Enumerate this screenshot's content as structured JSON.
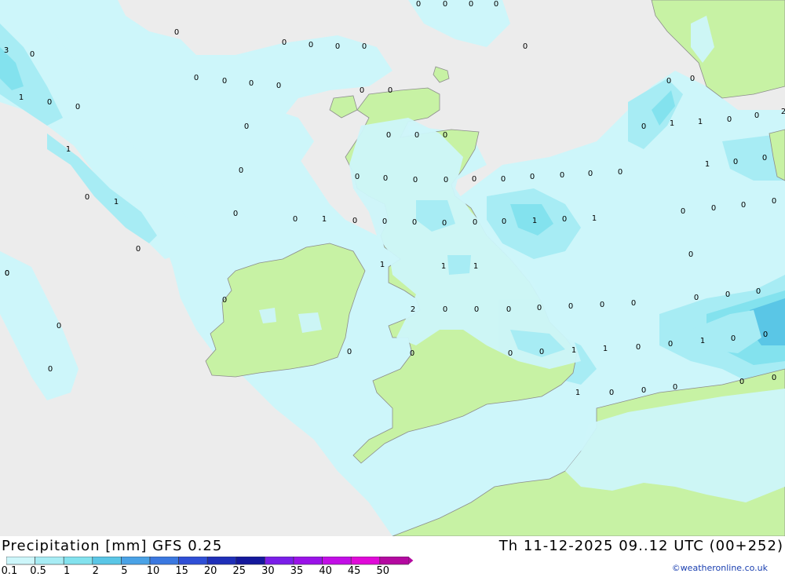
{
  "title": {
    "left": "Precipitation [mm] GFS 0.25",
    "right": "Th 11-12-2025 09..12 UTC (00+252)",
    "credit": "©weatheronline.co.uk"
  },
  "colors": {
    "sea": "#ececec",
    "land": "#c7f2a4",
    "border": "#8c8c8c",
    "precip_0_1": "#cdf6fa",
    "precip_0_5": "#a7ecf4",
    "precip_1": "#83e2ee",
    "precip_2": "#5ac6e6"
  },
  "legend": {
    "unit": "mm",
    "classes": [
      {
        "label": "0.1",
        "color": "#cdf6fa"
      },
      {
        "label": "0.5",
        "color": "#a7ecf4"
      },
      {
        "label": "1",
        "color": "#83e2ee"
      },
      {
        "label": "2",
        "color": "#5ac6e6"
      },
      {
        "label": "5",
        "color": "#4aa2e6"
      },
      {
        "label": "10",
        "color": "#3b78e0"
      },
      {
        "label": "15",
        "color": "#2f4fd6"
      },
      {
        "label": "20",
        "color": "#1f2fb8"
      },
      {
        "label": "25",
        "color": "#14189c"
      },
      {
        "label": "30",
        "color": "#7a1ee8"
      },
      {
        "label": "35",
        "color": "#9a12e8"
      },
      {
        "label": "40",
        "color": "#c20ee6"
      },
      {
        "label": "45",
        "color": "#e00ad8"
      },
      {
        "label": "50",
        "color": "#b40aa0"
      }
    ]
  },
  "map_values": {
    "note_none": "",
    "points": [
      {
        "v": "0"
      },
      {
        "v": "0"
      },
      {
        "v": "0"
      },
      {
        "v": "0"
      },
      {
        "v": "0"
      },
      {
        "v": "0"
      },
      {
        "v": "0"
      },
      {
        "v": "0"
      },
      {
        "v": "3"
      },
      {
        "v": "0"
      },
      {
        "v": "1"
      },
      {
        "v": "0"
      },
      {
        "v": "0"
      },
      {
        "v": "1"
      },
      {
        "v": "0"
      },
      {
        "v": "1"
      },
      {
        "v": "0"
      },
      {
        "v": "0"
      },
      {
        "v": "0"
      },
      {
        "v": "0"
      },
      {
        "v": "0"
      },
      {
        "v": "0"
      },
      {
        "v": "0"
      },
      {
        "v": "0"
      },
      {
        "v": "0"
      },
      {
        "v": "0"
      },
      {
        "v": "0"
      },
      {
        "v": "0"
      },
      {
        "v": "0"
      },
      {
        "v": "0"
      },
      {
        "v": "1"
      },
      {
        "v": "0"
      },
      {
        "v": "0"
      },
      {
        "v": "0"
      },
      {
        "v": "0"
      },
      {
        "v": "0"
      },
      {
        "v": "0"
      },
      {
        "v": "0"
      },
      {
        "v": "0"
      },
      {
        "v": "0"
      },
      {
        "v": "0"
      },
      {
        "v": "0"
      },
      {
        "v": "0"
      },
      {
        "v": "0"
      },
      {
        "v": "0"
      },
      {
        "v": "0"
      },
      {
        "v": "0"
      },
      {
        "v": "1"
      },
      {
        "v": "1"
      },
      {
        "v": "0"
      },
      {
        "v": "0"
      },
      {
        "v": "2"
      },
      {
        "v": "1"
      },
      {
        "v": "0"
      },
      {
        "v": "0"
      },
      {
        "v": "0"
      },
      {
        "v": "0"
      },
      {
        "v": "0"
      },
      {
        "v": "0"
      },
      {
        "v": "0"
      },
      {
        "v": "0"
      },
      {
        "v": "0"
      },
      {
        "v": "0"
      },
      {
        "v": "0"
      },
      {
        "v": "0"
      },
      {
        "v": "0"
      },
      {
        "v": "0"
      },
      {
        "v": "0"
      },
      {
        "v": "0"
      },
      {
        "v": "0"
      },
      {
        "v": "1"
      },
      {
        "v": "0"
      },
      {
        "v": "1"
      },
      {
        "v": "1"
      },
      {
        "v": "1"
      },
      {
        "v": "1"
      },
      {
        "v": "2"
      },
      {
        "v": "0"
      },
      {
        "v": "0"
      },
      {
        "v": "0"
      },
      {
        "v": "0"
      },
      {
        "v": "0"
      },
      {
        "v": "0"
      },
      {
        "v": "0"
      },
      {
        "v": "0"
      },
      {
        "v": "0"
      },
      {
        "v": "0"
      },
      {
        "v": "0"
      },
      {
        "v": "0"
      },
      {
        "v": "0"
      },
      {
        "v": "0"
      },
      {
        "v": "1"
      },
      {
        "v": "1"
      },
      {
        "v": "0"
      },
      {
        "v": "0"
      },
      {
        "v": "1"
      },
      {
        "v": "0"
      },
      {
        "v": "0"
      },
      {
        "v": "0"
      },
      {
        "v": "0"
      },
      {
        "v": "1"
      },
      {
        "v": "0"
      },
      {
        "v": "0"
      },
      {
        "v": "0"
      }
    ]
  }
}
